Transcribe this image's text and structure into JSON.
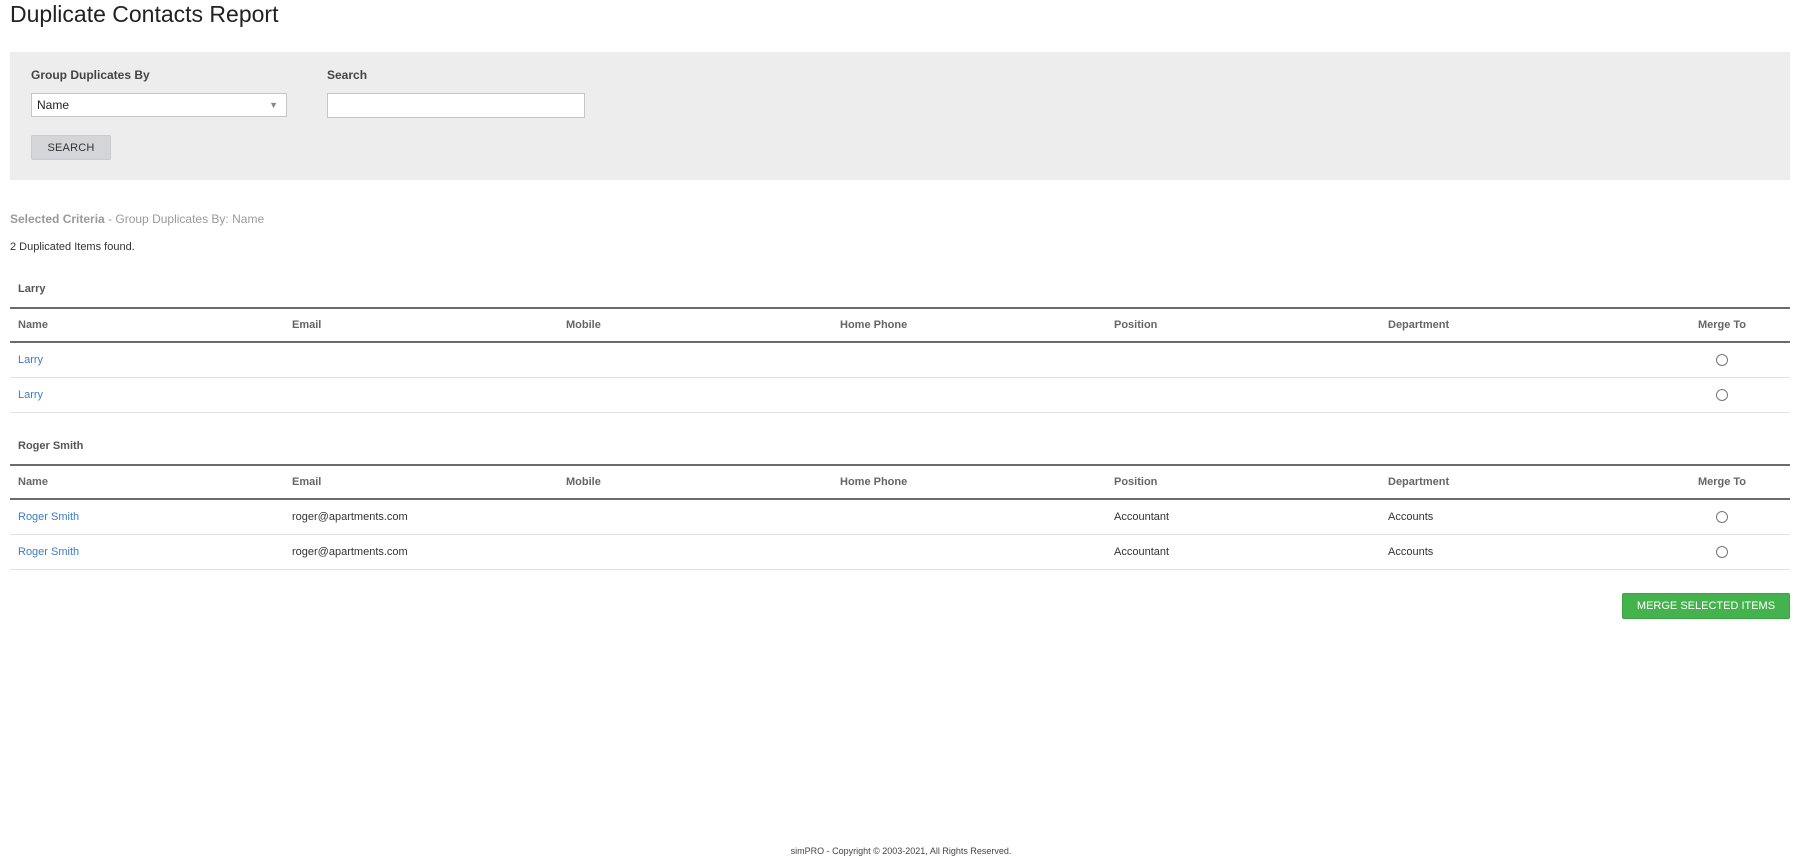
{
  "page": {
    "title": "Duplicate Contacts Report"
  },
  "filters": {
    "group_by_label": "Group Duplicates By",
    "group_by_value": "Name",
    "search_label": "Search",
    "search_value": "",
    "search_button": "SEARCH"
  },
  "criteria": {
    "label": "Selected Criteria",
    "text": " - Group Duplicates By: Name"
  },
  "results_text": "2 Duplicated Items found.",
  "columns": [
    "Name",
    "Email",
    "Mobile",
    "Home Phone",
    "Position",
    "Department",
    "Merge To"
  ],
  "groups": [
    {
      "title": "Larry",
      "rows": [
        {
          "name": "Larry",
          "email": "",
          "mobile": "",
          "home_phone": "",
          "position": "",
          "department": ""
        },
        {
          "name": "Larry",
          "email": "",
          "mobile": "",
          "home_phone": "",
          "position": "",
          "department": ""
        }
      ]
    },
    {
      "title": "Roger Smith",
      "rows": [
        {
          "name": "Roger Smith",
          "email": "roger@apartments.com",
          "mobile": "",
          "home_phone": "",
          "position": "Accountant",
          "department": "Accounts"
        },
        {
          "name": "Roger Smith",
          "email": "roger@apartments.com",
          "mobile": "",
          "home_phone": "",
          "position": "Accountant",
          "department": "Accounts"
        }
      ]
    }
  ],
  "merge_button": "MERGE SELECTED ITEMS",
  "footer": "simPRO - Copyright © 2003-2021, All Rights Reserved.",
  "colors": {
    "link": "#3b7dc4",
    "merge_button": "#45b34d",
    "filter_panel": "#ededed"
  }
}
